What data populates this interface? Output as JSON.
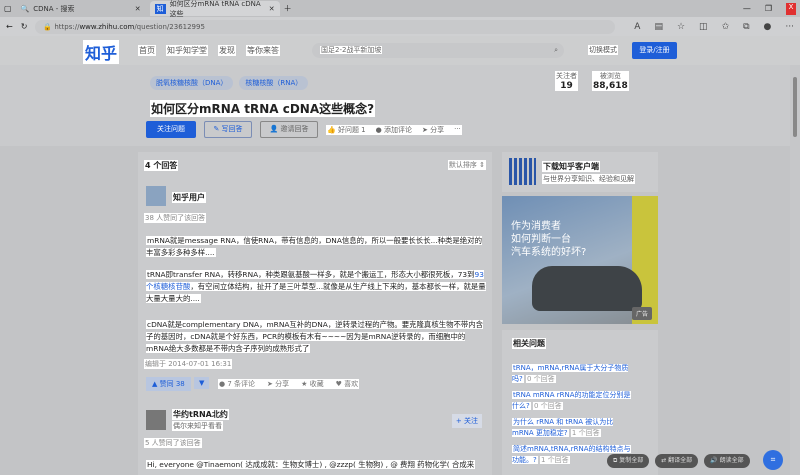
{
  "browser": {
    "tabs": [
      {
        "title": "CDNA - 搜索",
        "active": false
      },
      {
        "title": "如何区分mRNA tRNA cDNA这些",
        "active": true
      }
    ],
    "url_prefix": "https://",
    "url_host": "www.zhihu.com",
    "url_path": "/question/23612995"
  },
  "header": {
    "logo": "知乎",
    "nav": [
      "首页",
      "知乎知学堂",
      "发现",
      "等你来答"
    ],
    "search_placeholder": "国足2-2战平新加坡",
    "mode": "切换模式",
    "login": "登录/注册"
  },
  "question": {
    "topics": [
      "脱氧核糖核酸（DNA）",
      "核糖核酸（RNA）"
    ],
    "title": "如何区分mRNA tRNA cDNA这些概念?",
    "follow": "关注问题",
    "write": "写回答",
    "invite": "邀请回答",
    "good": "好问题 1",
    "comment": "添加评论",
    "share": "分享",
    "more": "···",
    "followers_label": "关注者",
    "followers": "19",
    "views_label": "被浏览",
    "views": "88,618"
  },
  "answers": {
    "count": "4 个回答",
    "sort": "默认排序",
    "a1": {
      "author": "知乎用户",
      "votes_text": "38 人赞同了该回答",
      "p1": "mRNA就是message RNA，信使RNA，带有信息的，DNA信息的，所以一般要长长长...种类是绝对的丰富多彩多种多样....",
      "p2a": "tRNA即transfer RNA，转移RNA，种类跟氨基酸一样多，就是个搬运工，形态大小都很死板，73到",
      "p2link": "93个核糖核苷酸",
      "p2b": "，有空间立体结构，扯开了是三叶草型...就像是从生产线上下来的，基本都长一样，就是量大量大量大的....",
      "p3": "cDNA就是complementary DNA，mRNA互补的DNA，逆转录过程的产物。要克隆真核生物不带内含子的基因时，cDNA就是个好东西，PCR的模板有木有~~~~因为是mRNA逆转录的，而细胞中的mRNA绝大多数都是不带内含子序列的成熟形式了",
      "edited": "编辑于 2014-07-01 16:31",
      "upvote": "▲ 赞同 38",
      "comments": "7 条评论",
      "share": "分享",
      "collect": "收藏",
      "like": "喜欢"
    },
    "a2": {
      "author": "华约tRNA北约",
      "bio": "偶尔来知乎看看",
      "follow": "+ 关注",
      "votes_text": "5 人赞同了该回答",
      "p1": "Hi, everyone @Tinaemon( 达成成就：生物女博士) , @zzzp( 生物狗) , @ 费翔 药物化学( 合成来"
    }
  },
  "sidebar": {
    "app_title": "下载知乎客户端",
    "app_sub": "与世界分享知识、经验和见解",
    "ad_text": [
      "作为消费者",
      "如何判断一台",
      "汽车系统的好坏?"
    ],
    "ad_tag": "广告",
    "related_title": "相关问题",
    "related": [
      {
        "q": "tRNA，mRNA,rRNA属于大分子物质吗?",
        "n": "0 个回答"
      },
      {
        "q": "tRNA mRNA rRNA的功能定位分别是什么?",
        "n": "0 个回答"
      },
      {
        "q": "为什么 rRNA 和 tRNA 被认为比 mRNA 更加稳定?",
        "n": "1 个回答"
      },
      {
        "q": "简述mRNA,tRNA,rRNA的结构特点与功能。?",
        "n": "1 个回答"
      }
    ]
  },
  "floatbar": {
    "copy": "复制全部",
    "translate": "翻译全部",
    "read": "朗读全部"
  }
}
